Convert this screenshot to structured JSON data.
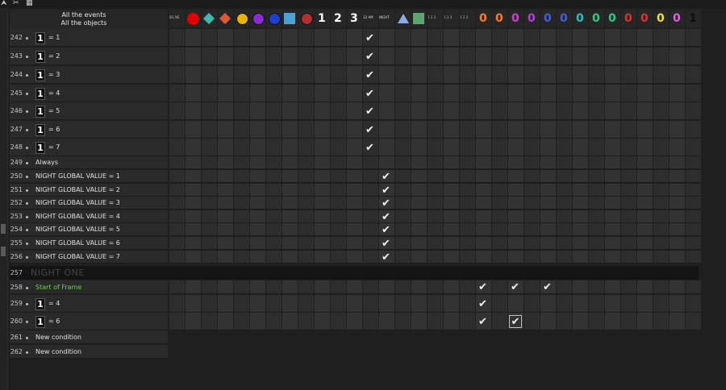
{
  "header": {
    "line1": "All the events",
    "line2": "All the objects"
  },
  "topbar_icons": [
    "cursor-icon",
    "scissors-icon",
    "grid-icon"
  ],
  "columns": [
    {
      "id": "c0",
      "kind": "text",
      "label": "BG NE",
      "color": "#bbbbbb"
    },
    {
      "id": "c1",
      "kind": "circle",
      "color": "#e00000"
    },
    {
      "id": "c2",
      "kind": "diamond",
      "color": "#3fb8b0"
    },
    {
      "id": "c3",
      "kind": "diamond",
      "color": "#d95a3a"
    },
    {
      "id": "c4",
      "kind": "round",
      "color": "#e8b400"
    },
    {
      "id": "c5",
      "kind": "round",
      "color": "#8b2ad4"
    },
    {
      "id": "c6",
      "kind": "round",
      "color": "#1f3fd0"
    },
    {
      "id": "c7",
      "kind": "square",
      "color": "#4aa3d8"
    },
    {
      "id": "c8",
      "kind": "round",
      "color": "#b03030"
    },
    {
      "id": "c9",
      "kind": "glyph",
      "label": "1",
      "color": "#ffffff"
    },
    {
      "id": "c10",
      "kind": "glyph",
      "label": "2",
      "color": "#ffffff"
    },
    {
      "id": "c11",
      "kind": "glyph",
      "label": "3",
      "color": "#ffffff"
    },
    {
      "id": "c12",
      "kind": "text",
      "label": "12 AM",
      "color": "#dddddd"
    },
    {
      "id": "c13",
      "kind": "text",
      "label": "NIGHT",
      "color": "#dddddd"
    },
    {
      "id": "c14",
      "kind": "triangle",
      "color": "#8fa8e8"
    },
    {
      "id": "c15",
      "kind": "square",
      "color": "#5aa870"
    },
    {
      "id": "c16",
      "kind": "text",
      "label": "1 2 3",
      "color": "#bbbbbb"
    },
    {
      "id": "c17",
      "kind": "text",
      "label": "1 2 3",
      "color": "#bbbbbb"
    },
    {
      "id": "c18",
      "kind": "text",
      "label": "1 2 3",
      "color": "#bbbbbb"
    },
    {
      "id": "c19",
      "kind": "zero",
      "label": "0",
      "color": "#ff7a1a"
    },
    {
      "id": "c20",
      "kind": "zero",
      "label": "0",
      "color": "#ff7a1a"
    },
    {
      "id": "c21",
      "kind": "zero",
      "label": "0",
      "color": "#d040d0"
    },
    {
      "id": "c22",
      "kind": "zero",
      "label": "0",
      "color": "#b040e0"
    },
    {
      "id": "c23",
      "kind": "zero",
      "label": "0",
      "color": "#4060e0"
    },
    {
      "id": "c24",
      "kind": "zero",
      "label": "0",
      "color": "#4060e0"
    },
    {
      "id": "c25",
      "kind": "zero",
      "label": "0",
      "color": "#20c0c0"
    },
    {
      "id": "c26",
      "kind": "zero",
      "label": "0",
      "color": "#20d080"
    },
    {
      "id": "c27",
      "kind": "zero",
      "label": "0",
      "color": "#20d080"
    },
    {
      "id": "c28",
      "kind": "zero",
      "label": "0",
      "color": "#e03030"
    },
    {
      "id": "c29",
      "kind": "zero",
      "label": "0",
      "color": "#e03030"
    },
    {
      "id": "c30",
      "kind": "zero",
      "label": "0",
      "color": "#f0e020"
    },
    {
      "id": "c31",
      "kind": "zero",
      "label": "0",
      "color": "#e060e0"
    },
    {
      "id": "c32",
      "kind": "zero",
      "label": "1",
      "color": "#111111"
    }
  ],
  "events": [
    {
      "num": "242",
      "kind": "counter",
      "text": "= 1"
    },
    {
      "num": "243",
      "kind": "counter",
      "text": "= 2"
    },
    {
      "num": "244",
      "kind": "counter",
      "text": "= 3"
    },
    {
      "num": "245",
      "kind": "counter",
      "text": "= 4"
    },
    {
      "num": "246",
      "kind": "counter",
      "text": "= 5"
    },
    {
      "num": "247",
      "kind": "counter",
      "text": "= 6"
    },
    {
      "num": "248",
      "kind": "counter",
      "text": "= 7"
    },
    {
      "num": "249",
      "kind": "plain",
      "text": "Always"
    },
    {
      "num": "250",
      "kind": "plain",
      "text": "NIGHT GLOBAL VALUE = 1"
    },
    {
      "num": "251",
      "kind": "plain",
      "text": "NIGHT GLOBAL VALUE = 2"
    },
    {
      "num": "252",
      "kind": "plain",
      "text": "NIGHT GLOBAL VALUE = 3"
    },
    {
      "num": "253",
      "kind": "plain",
      "text": "NIGHT GLOBAL VALUE = 4"
    },
    {
      "num": "254",
      "kind": "plain",
      "text": "NIGHT GLOBAL VALUE = 5"
    },
    {
      "num": "255",
      "kind": "plain",
      "text": "NIGHT GLOBAL VALUE = 6"
    },
    {
      "num": "256",
      "kind": "plain",
      "text": "NIGHT GLOBAL VALUE = 7"
    },
    {
      "num": "257",
      "kind": "group",
      "text": "NIGHT ONE"
    },
    {
      "num": "258",
      "kind": "green",
      "text": "Start of Frame"
    },
    {
      "num": "259",
      "kind": "counter",
      "text": "= 4"
    },
    {
      "num": "260",
      "kind": "counter",
      "text": "= 6"
    },
    {
      "num": "261",
      "kind": "plain",
      "text": "New condition"
    },
    {
      "num": "262",
      "kind": "plain",
      "text": "New condition"
    }
  ],
  "checks": [
    {
      "event": "242",
      "column": 12
    },
    {
      "event": "243",
      "column": 12
    },
    {
      "event": "244",
      "column": 12
    },
    {
      "event": "245",
      "column": 12
    },
    {
      "event": "246",
      "column": 12
    },
    {
      "event": "247",
      "column": 12
    },
    {
      "event": "248",
      "column": 12
    },
    {
      "event": "250",
      "column": 13
    },
    {
      "event": "251",
      "column": 13
    },
    {
      "event": "252",
      "column": 13
    },
    {
      "event": "253",
      "column": 13
    },
    {
      "event": "254",
      "column": 13
    },
    {
      "event": "255",
      "column": 13
    },
    {
      "event": "256",
      "column": 13
    },
    {
      "event": "258",
      "column": 19
    },
    {
      "event": "258",
      "column": 21
    },
    {
      "event": "258",
      "column": 23
    },
    {
      "event": "259",
      "column": 19
    },
    {
      "event": "260",
      "column": 19
    },
    {
      "event": "260",
      "column": 21,
      "boxed": true
    }
  ],
  "counter_icon_label": "1",
  "check_glyph": "✔"
}
